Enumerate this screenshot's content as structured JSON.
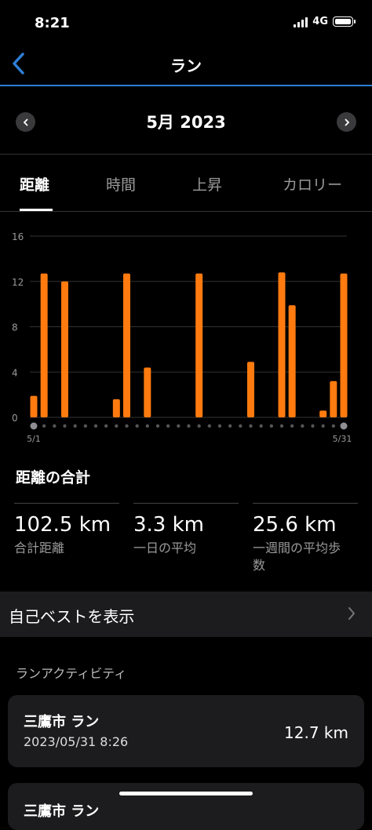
{
  "status": {
    "time": "8:21",
    "network": "4G"
  },
  "nav": {
    "title": "ラン"
  },
  "month": {
    "label": "5月 2023"
  },
  "tabs": [
    {
      "label": "距離",
      "active": true
    },
    {
      "label": "時間",
      "active": false
    },
    {
      "label": "上昇",
      "active": false
    },
    {
      "label": "カロリー",
      "active": false
    }
  ],
  "chart_data": {
    "type": "bar",
    "ylim": [
      0,
      16
    ],
    "yticks": [
      "0",
      "4",
      "8",
      "12",
      "16"
    ],
    "x_start_label": "5/1",
    "x_end_label": "5/31",
    "grid": true,
    "bar_color": "#ff7a0f",
    "x": [
      1,
      2,
      3,
      4,
      5,
      6,
      7,
      8,
      9,
      10,
      11,
      12,
      13,
      14,
      15,
      16,
      17,
      18,
      19,
      20,
      21,
      22,
      23,
      24,
      25,
      26,
      27,
      28,
      29,
      30,
      31
    ],
    "values": [
      1.9,
      12.7,
      0,
      12.0,
      0,
      0,
      0,
      0,
      1.6,
      12.7,
      0,
      4.4,
      0,
      0,
      0,
      0,
      12.7,
      0,
      0,
      0,
      0,
      4.9,
      0,
      0,
      12.8,
      9.9,
      0,
      0,
      0.6,
      3.2,
      12.7
    ],
    "selected_x": [
      1,
      31
    ]
  },
  "summary": {
    "title": "距離の合計",
    "stats": [
      {
        "value": "102.5 km",
        "label": "合計距離"
      },
      {
        "value": "3.3 km",
        "label": "一日の平均"
      },
      {
        "value": "25.6 km",
        "label": "一週間の平均歩数"
      }
    ]
  },
  "best": {
    "label": "自己ベストを表示"
  },
  "activities": {
    "title": "ランアクティビティ",
    "items": [
      {
        "name": "三鷹市 ラン",
        "date": "2023/05/31 8:26",
        "distance": "12.7 km"
      },
      {
        "name": "三鷹市 ラン",
        "date": "",
        "distance": ""
      }
    ]
  }
}
